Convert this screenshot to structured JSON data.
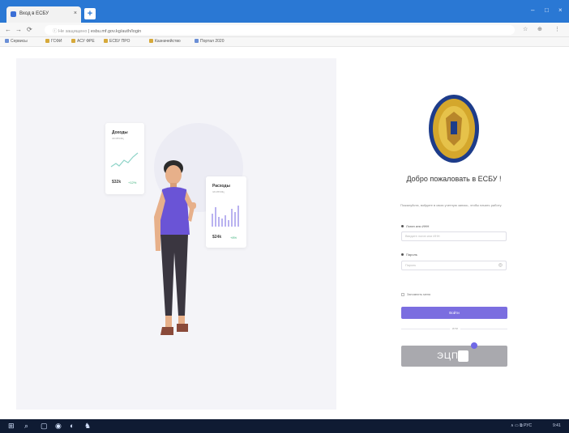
{
  "browser": {
    "tab_title": "Вход в ЕСБУ",
    "tab_close": "×",
    "new_tab": "+",
    "window_controls": [
      "–",
      "□",
      "×"
    ],
    "nav": [
      "←",
      "→",
      "⟳"
    ],
    "url_prefix": "ⓘ Не защищено",
    "url": "esbu.mf.gov.kg/auth/login",
    "toolbar_icons": [
      "☆",
      "⊕",
      "⋮"
    ],
    "bookmarks": [
      {
        "label": "Сервисы",
        "color": "#6b8fd6"
      },
      {
        "label": "ГСФИ",
        "color": "#d6a93a"
      },
      {
        "label": "АСУ ФРЕ",
        "color": "#d6a93a"
      },
      {
        "label": "ЕСБУ ПРО",
        "color": "#d6a93a"
      },
      {
        "label": "Казначейство",
        "color": "#d6a93a"
      },
      {
        "label": "Портал 2020",
        "color": "#6b8fd6"
      }
    ]
  },
  "hero": {
    "card1": {
      "title": "Доходы",
      "subtitle": "за месяц",
      "value": "$32k",
      "delta": "+12%"
    },
    "card2": {
      "title": "Расходы",
      "subtitle": "за месяц",
      "value": "$24k",
      "delta": "+8%"
    }
  },
  "login": {
    "welcome": "Добро пожаловать в ЕСБУ !",
    "intro": "Пожалуйста, войдите в свою учетную запись, чтобы начать работу.",
    "username_label": "Логин или ИНН",
    "username_placeholder": "Введите логин или ИНН",
    "password_label": "Пароль",
    "password_placeholder": "Пароль",
    "remember": "Запомнить меня",
    "login_button": "Войти",
    "or": "или",
    "esign_text": "ЭЦП"
  },
  "taskbar": {
    "icons": [
      "⊞",
      "⌕",
      "▢",
      "◉",
      "◐",
      "♞"
    ],
    "tray": "∧  ▭  ⧉  РУС",
    "clock": "9:41"
  },
  "colors": {
    "accent": "#7b6ee0",
    "tabbar": "#2a78d4",
    "taskbar": "#0f1b33"
  }
}
